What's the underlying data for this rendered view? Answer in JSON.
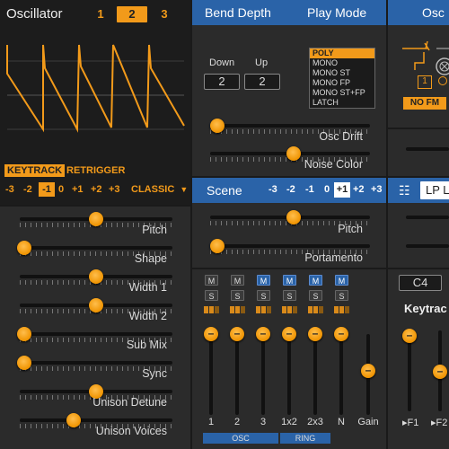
{
  "oscillator": {
    "title": "Oscillator",
    "tabs": [
      "1",
      "2",
      "3"
    ],
    "selected_tab": "2",
    "keytrack": "KEYTRACK",
    "retrigger": "RETRIGGER",
    "octaves": [
      "-3",
      "-2",
      "-1",
      "0",
      "+1",
      "+2",
      "+3"
    ],
    "selected_octave": "-1",
    "type": "CLASSIC",
    "params": [
      {
        "label": "Pitch",
        "value": 0.5
      },
      {
        "label": "Shape",
        "value": 0.03
      },
      {
        "label": "Width 1",
        "value": 0.5
      },
      {
        "label": "Width 2",
        "value": 0.5
      },
      {
        "label": "Sub Mix",
        "value": 0.03
      },
      {
        "label": "Sync",
        "value": 0.03
      },
      {
        "label": "Unison Detune",
        "value": 0.5
      },
      {
        "label": "Unison Voices",
        "value": 0.35
      }
    ]
  },
  "bend": {
    "title": "Bend Depth",
    "down_label": "Down",
    "up_label": "Up",
    "down_value": "2",
    "up_value": "2"
  },
  "playmode": {
    "title": "Play Mode",
    "options": [
      "POLY",
      "MONO",
      "MONO ST",
      "MONO FP",
      "MONO ST+FP",
      "LATCH"
    ],
    "selected": "POLY",
    "osc_drift_label": "Osc Drift",
    "osc_drift_value": 0.0,
    "noise_color_label": "Noise Color",
    "noise_color_value": 0.5
  },
  "scene": {
    "title": "Scene",
    "octaves": [
      "-3",
      "-2",
      "-1",
      "0",
      "+1",
      "+2",
      "+3"
    ],
    "selected_octave": "+1",
    "pitch_label": "Pitch",
    "pitch_value": 0.5,
    "portamento_label": "Portamento",
    "portamento_value": 0.0
  },
  "mixer": {
    "channels": [
      {
        "label": "1",
        "m": false,
        "s": "S",
        "level": 1.0
      },
      {
        "label": "2",
        "m": false,
        "s": "S",
        "level": 1.0
      },
      {
        "label": "3",
        "m": true,
        "s": "S",
        "level": 1.0
      },
      {
        "label": "1x2",
        "m": true,
        "s": "S",
        "level": 1.0
      },
      {
        "label": "2x3",
        "m": true,
        "s": "S",
        "level": 1.0
      },
      {
        "label": "N",
        "m": true,
        "s": "S",
        "level": 1.0
      }
    ],
    "m_label": "M",
    "gain_label": "Gain",
    "gain_value": 0.55,
    "osc_group": "OSC",
    "ring_group": "RING"
  },
  "right": {
    "osc_title": "Osc",
    "routing_number": "1",
    "nofm": "NO FM",
    "lp_label": "LP L",
    "c4": "C4",
    "keytrack": "Keytrac",
    "f1": "▸F1",
    "f2": "▸F2"
  }
}
